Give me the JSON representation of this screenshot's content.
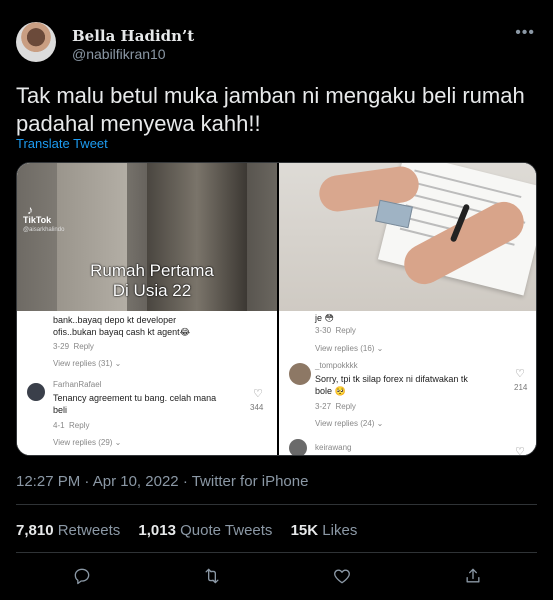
{
  "author": {
    "display_name": "Bella Hadidn’t",
    "handle": "@nabilfikran10"
  },
  "more_icon": "more-icon",
  "tweet": {
    "text_line1": "Tak malu betul muka jamban ni mengaku beli rumah",
    "text_line2": "padahal menyewa kahh!!",
    "translate_label": "Translate Tweet"
  },
  "media": {
    "left": {
      "tiktok_label": "TikTok",
      "tiktok_user": "@aisarkhalindo",
      "caption_line1": "Rumah Pertama",
      "caption_line2": "Di Usia 22",
      "comments": [
        {
          "text_line1": "bank..bayaq depo kt developer",
          "text_line2": "ofis..bukan bayaq cash kt agent😂",
          "date": "3-29",
          "reply": "Reply",
          "view_replies": "View replies (31)"
        },
        {
          "user": "FarhanRafael",
          "text_line1": "Tenancy agreement tu bang. celah mana",
          "text_line2": "beli",
          "date": "4-1",
          "reply": "Reply",
          "likes": "344",
          "view_replies": "View replies (29)"
        }
      ]
    },
    "right": {
      "comments": [
        {
          "text_line1": "je 😳",
          "date": "3-30",
          "reply": "Reply",
          "view_replies": "View replies (16)"
        },
        {
          "user": "_tompokkkk",
          "text_line1": "Sorry, tpi tk silap forex ni difatwakan tk",
          "text_line2": "bole 🥺",
          "date": "3-27",
          "reply": "Reply",
          "likes": "214",
          "view_replies": "View replies (24)"
        },
        {
          "user": "keirawang"
        }
      ]
    }
  },
  "meta": {
    "time": "12:27 PM",
    "date": "Apr 10, 2022",
    "source": "Twitter for iPhone",
    "separator": "·"
  },
  "stats": {
    "retweets_count": "7,810",
    "retweets_label": "Retweets",
    "quotes_count": "1,013",
    "quotes_label": "Quote Tweets",
    "likes_count": "15K",
    "likes_label": "Likes"
  },
  "actions": [
    "reply-icon",
    "retweet-icon",
    "like-icon",
    "share-icon"
  ],
  "colors": {
    "background": "#000000",
    "text": "#e7e9ea",
    "secondary": "#8b98a5",
    "link": "#1d9bf0",
    "border": "#2f3336"
  }
}
